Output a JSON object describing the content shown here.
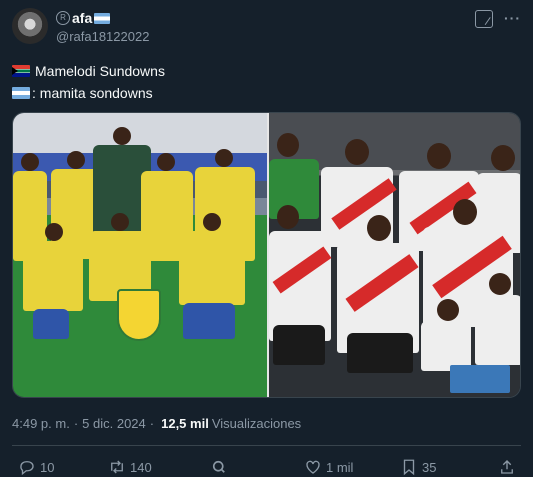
{
  "author": {
    "display_name": "afa",
    "handle": "@rafa18122022"
  },
  "tweet": {
    "line1": "Mamelodi Sundowns",
    "line2": ": mamita sondowns"
  },
  "meta": {
    "time": "4:49 p. m.",
    "date": "5 dic. 2024",
    "views_count": "12,5 mil",
    "views_label": "Visualizaciones"
  },
  "actions": {
    "replies": "10",
    "reposts": "140",
    "likes": "1 mil",
    "bookmarks": "35"
  }
}
